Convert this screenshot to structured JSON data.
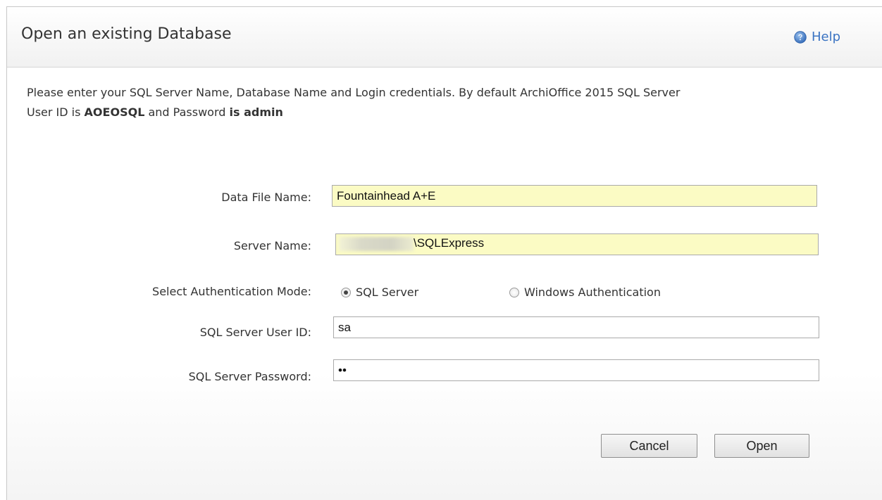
{
  "dialog": {
    "title": "Open an existing Database",
    "help_label": "Help",
    "help_icon": "help-circle-icon"
  },
  "intro": {
    "line1_part1": "Please enter your SQL Server Name, Database Name and Login credentials. By default ArchiOffice 2015 SQL Server",
    "line2_part1": "User ID is ",
    "line2_bold1": "AOEOSQL",
    "line2_part2": " and Password ",
    "line2_bold2": "is admin"
  },
  "form": {
    "data_file_label": "Data File Name:",
    "data_file_value": "Fountainhead A+E",
    "server_name_label": "Server Name:",
    "server_name_value": "\\SQLExpress",
    "auth_mode_label": "Select Authentication Mode:",
    "auth_options": [
      "SQL Server",
      "Windows Authentication"
    ],
    "auth_selected": "SQL Server",
    "user_id_label": "SQL Server User ID:",
    "user_id_value": "sa",
    "password_label": "SQL Server Password:",
    "password_value": "••"
  },
  "buttons": {
    "cancel_label": "Cancel",
    "open_label": "Open"
  }
}
